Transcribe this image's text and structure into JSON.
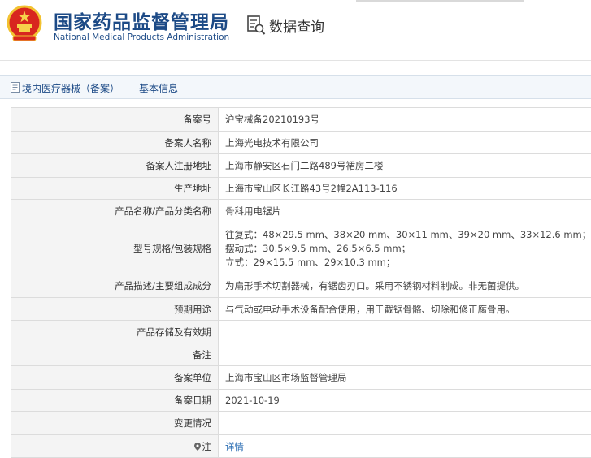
{
  "header": {
    "site_title_cn": "国家药品监督管理局",
    "site_title_en": "National Medical Products Administration",
    "data_query_label": "数据查询"
  },
  "section": {
    "title": "境内医疗器械（备案）——基本信息"
  },
  "rows": [
    {
      "label": "备案号",
      "value": "沪宝械备20210193号"
    },
    {
      "label": "备案人名称",
      "value": "上海光电技术有限公司"
    },
    {
      "label": "备案人注册地址",
      "value": "上海市静安区石门二路489号裙房二楼"
    },
    {
      "label": "生产地址",
      "value": "上海市宝山区长江路43号2幢2A113-116"
    },
    {
      "label": "产品名称/产品分类名称",
      "value": "骨科用电锯片"
    },
    {
      "label": "型号规格/包装规格",
      "lines": [
        "往复式：48×29.5 mm、38×20 mm、30×11 mm、39×20 mm、33×12.6 mm；",
        "摆动式：30.5×9.5 mm、26.5×6.5 mm；",
        "立式：29×15.5 mm、29×10.3 mm；"
      ]
    },
    {
      "label": "产品描述/主要组成成分",
      "value": "为扁形手术切割器械，有锯齿刃口。采用不锈钢材料制成。非无菌提供。"
    },
    {
      "label": "预期用途",
      "value": "与气动或电动手术设备配合使用，用于截锯骨骼、切除和修正腐骨用。"
    },
    {
      "label": "产品存储及有效期",
      "value": ""
    },
    {
      "label": "备注",
      "value": ""
    },
    {
      "label": "备案单位",
      "value": "上海市宝山区市场监督管理局"
    },
    {
      "label": "备案日期",
      "value": "2021-10-19"
    },
    {
      "label": "变更情况",
      "value": ""
    },
    {
      "label": "注",
      "value": "详情"
    }
  ],
  "icons": {
    "emblem": "national-emblem-icon",
    "data_query": "data-query-icon",
    "section": "document-icon",
    "note": "pin-icon"
  },
  "colors": {
    "brand": "#1c4a86",
    "link": "#2a6db3",
    "label_bg": "#f4f4f4",
    "border": "#dcdcdc"
  }
}
